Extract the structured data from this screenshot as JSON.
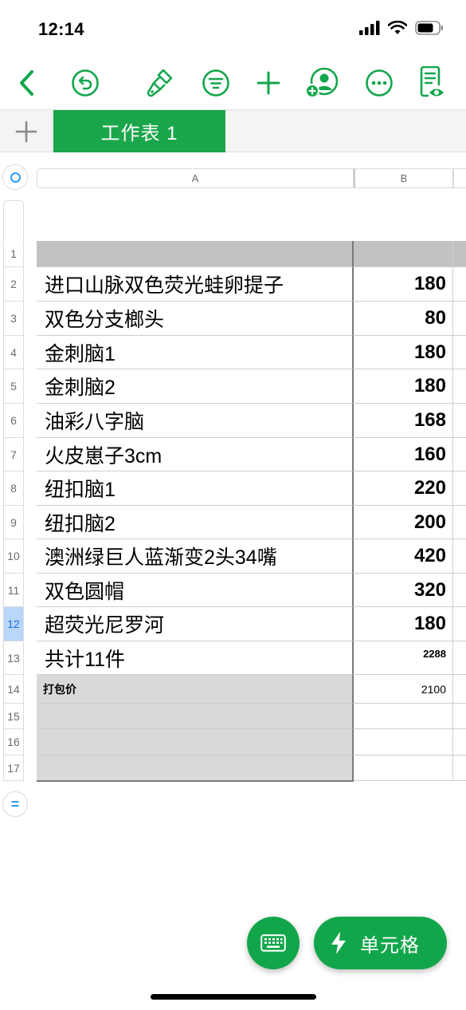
{
  "status_bar": {
    "time": "12:14"
  },
  "toolbar": {
    "icons": [
      "back-icon",
      "undo-icon",
      "format-brush-icon",
      "filter-icon",
      "add-icon",
      "collaborate-icon",
      "more-icon",
      "reader-view-icon"
    ]
  },
  "sheet_tabs": {
    "add_label": "+",
    "active_tab": "工作表 1"
  },
  "columns": [
    "A",
    "B"
  ],
  "rows": [
    {
      "num": "1",
      "a": "",
      "b": ""
    },
    {
      "num": "2",
      "a": "进口山脉双色荧光蛙卵提子",
      "b": "180"
    },
    {
      "num": "3",
      "a": "双色分支榔头",
      "b": "80"
    },
    {
      "num": "4",
      "a": "金刺脑1",
      "b": "180"
    },
    {
      "num": "5",
      "a": "金刺脑2",
      "b": "180"
    },
    {
      "num": "6",
      "a": "油彩八字脑",
      "b": "168"
    },
    {
      "num": "7",
      "a": "火皮崽子3cm",
      "b": "160"
    },
    {
      "num": "8",
      "a": "纽扣脑1",
      "b": "220"
    },
    {
      "num": "9",
      "a": "纽扣脑2",
      "b": "200"
    },
    {
      "num": "10",
      "a": "澳洲绿巨人蓝渐变2头34嘴",
      "b": "420"
    },
    {
      "num": "11",
      "a": "双色圆帽",
      "b": "320"
    },
    {
      "num": "12",
      "a": "超荧光尼罗河",
      "b": "180"
    },
    {
      "num": "13",
      "a": "共计11件",
      "b": "2288"
    },
    {
      "num": "14",
      "a": "打包价",
      "b": "2100"
    },
    {
      "num": "15",
      "a": "",
      "b": ""
    },
    {
      "num": "16",
      "a": "",
      "b": ""
    },
    {
      "num": "17",
      "a": "",
      "b": ""
    }
  ],
  "selected_row": "12",
  "add_row_symbol": "=",
  "bottom_buttons": {
    "keyboard_icon": "keyboard-icon",
    "cell_label": "单元格"
  },
  "colors": {
    "accent": "#12a64b",
    "selection": "#2f9bf5"
  }
}
